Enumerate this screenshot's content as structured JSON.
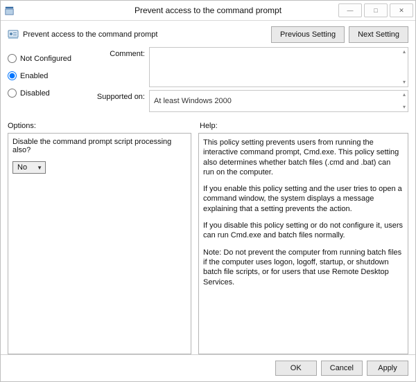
{
  "window": {
    "title": "Prevent access to the command prompt"
  },
  "header": {
    "title": "Prevent access to the command prompt",
    "previous": "Previous Setting",
    "next": "Next Setting"
  },
  "state": {
    "not_configured": "Not Configured",
    "enabled": "Enabled",
    "disabled": "Disabled",
    "selected": "enabled"
  },
  "meta": {
    "comment_label": "Comment:",
    "comment_value": "",
    "supported_label": "Supported on:",
    "supported_value": "At least Windows 2000"
  },
  "sections": {
    "options_label": "Options:",
    "help_label": "Help:"
  },
  "options": {
    "question": "Disable the command prompt script processing also?",
    "select_value": "No"
  },
  "help": {
    "p1": "This policy setting prevents users from running the interactive command prompt, Cmd.exe.  This policy setting also determines whether batch files (.cmd and .bat) can run on the computer.",
    "p2": "If you enable this policy setting and the user tries to open a command window, the system displays a message explaining that a setting prevents the action.",
    "p3": "If you disable this policy setting or do not configure it, users can run Cmd.exe and batch files normally.",
    "p4": "Note: Do not prevent the computer from running batch files if the computer uses logon, logoff, startup, or shutdown batch file scripts, or for users that use Remote Desktop Services."
  },
  "footer": {
    "ok": "OK",
    "cancel": "Cancel",
    "apply": "Apply"
  }
}
